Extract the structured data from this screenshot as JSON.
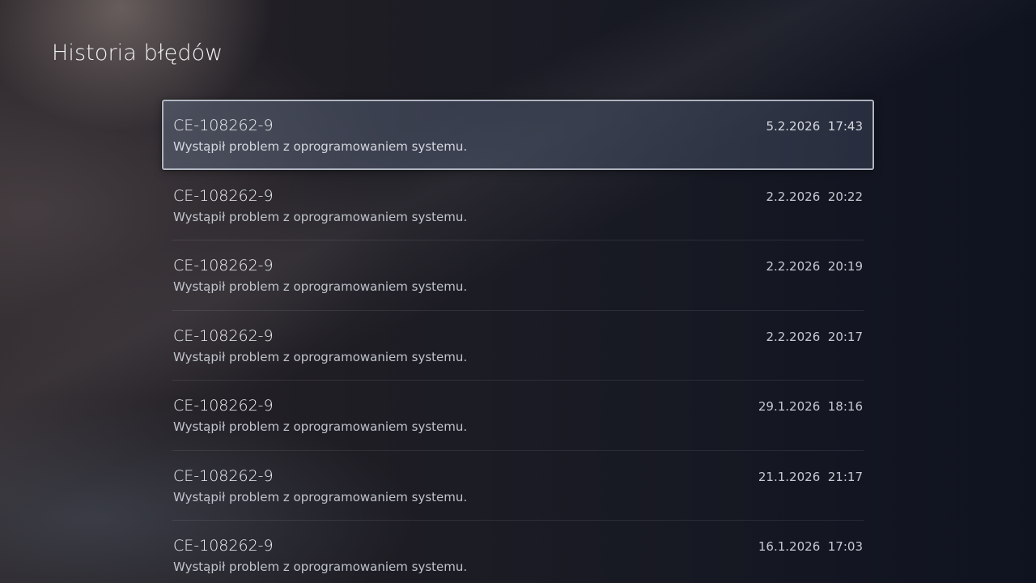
{
  "page": {
    "title": "Historia błędów"
  },
  "errors": [
    {
      "code": "CE-108262-9",
      "description": "Wystąpił problem z oprogramowaniem systemu.",
      "date": "5.2.2026  17:43",
      "selected": true
    },
    {
      "code": "CE-108262-9",
      "description": "Wystąpił problem z oprogramowaniem systemu.",
      "date": "2.2.2026  20:22",
      "selected": false
    },
    {
      "code": "CE-108262-9",
      "description": "Wystąpił problem z oprogramowaniem systemu.",
      "date": "2.2.2026  20:19",
      "selected": false
    },
    {
      "code": "CE-108262-9",
      "description": "Wystąpił problem z oprogramowaniem systemu.",
      "date": "2.2.2026  20:17",
      "selected": false
    },
    {
      "code": "CE-108262-9",
      "description": "Wystąpił problem z oprogramowaniem systemu.",
      "date": "29.1.2026  18:16",
      "selected": false
    },
    {
      "code": "CE-108262-9",
      "description": "Wystąpił problem z oprogramowaniem systemu.",
      "date": "21.1.2026  21:17",
      "selected": false
    },
    {
      "code": "CE-108262-9",
      "description": "Wystąpił problem z oprogramowaniem systemu.",
      "date": "16.1.2026  17:03",
      "selected": false
    }
  ],
  "colors": {
    "background": "#14151e",
    "text_primary": "#eef0f4",
    "text_secondary": "#bfc3cb",
    "focus_border": "#d7dce8"
  }
}
